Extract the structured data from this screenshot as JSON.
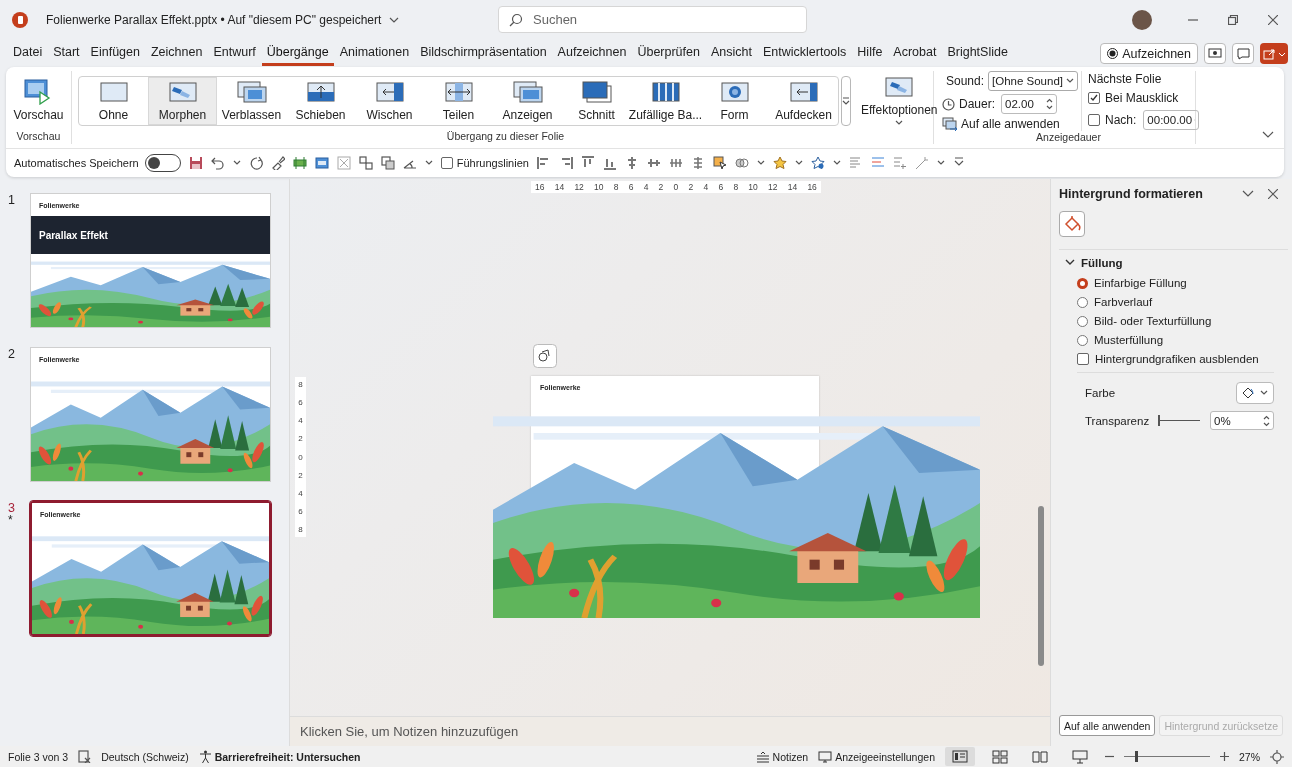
{
  "window": {
    "title": "Folienwerke Parallax Effekt.pptx • Auf \"diesem PC\" gespeichert"
  },
  "search": {
    "placeholder": "Suchen"
  },
  "menu": [
    {
      "label": "Datei",
      "selected": false
    },
    {
      "label": "Start",
      "selected": false
    },
    {
      "label": "Einfügen",
      "selected": false
    },
    {
      "label": "Zeichnen",
      "selected": false
    },
    {
      "label": "Entwurf",
      "selected": false
    },
    {
      "label": "Übergänge",
      "selected": true
    },
    {
      "label": "Animationen",
      "selected": false
    },
    {
      "label": "Bildschirmpräsentation",
      "selected": false
    },
    {
      "label": "Aufzeichnen",
      "selected": false
    },
    {
      "label": "Überprüfen",
      "selected": false
    },
    {
      "label": "Ansicht",
      "selected": false
    },
    {
      "label": "Entwicklertools",
      "selected": false
    },
    {
      "label": "Hilfe",
      "selected": false
    },
    {
      "label": "Acrobat",
      "selected": false
    },
    {
      "label": "BrightSlide",
      "selected": false
    }
  ],
  "record_button": "Aufzeichnen",
  "ribbon": {
    "preview": {
      "label": "Vorschau",
      "group": "Vorschau"
    },
    "transitions": {
      "group": "Übergang zu dieser Folie",
      "items": [
        {
          "label": "Ohne",
          "kind": "none",
          "selected": false
        },
        {
          "label": "Morphen",
          "kind": "morph",
          "selected": true
        },
        {
          "label": "Verblassen",
          "kind": "fade",
          "selected": false
        },
        {
          "label": "Schieben",
          "kind": "push",
          "selected": false
        },
        {
          "label": "Wischen",
          "kind": "wipe",
          "selected": false
        },
        {
          "label": "Teilen",
          "kind": "split",
          "selected": false
        },
        {
          "label": "Anzeigen",
          "kind": "reveal",
          "selected": false
        },
        {
          "label": "Schnitt",
          "kind": "cut",
          "selected": false
        },
        {
          "label": "Zufällige Ba...",
          "kind": "bars",
          "selected": false
        },
        {
          "label": "Form",
          "kind": "shape",
          "selected": false
        },
        {
          "label": "Aufdecken",
          "kind": "uncover",
          "selected": false
        }
      ]
    },
    "effect_options": "Effektoptionen",
    "timing": {
      "group": "Anzeigedauer",
      "sound_label": "Sound:",
      "sound_value": "[Ohne Sound]",
      "duration_label": "Dauer:",
      "duration_value": "02.00",
      "apply_all": "Auf alle anwenden",
      "next_slide": "Nächste Folie",
      "on_click": {
        "label": "Bei Mausklick",
        "checked": true
      },
      "after": {
        "label": "Nach:",
        "checked": false,
        "value": "00:00.00"
      }
    }
  },
  "quick_access": {
    "autosave_label": "Automatisches Speichern",
    "autosave_on": false,
    "guides": {
      "label": "Führungslinien",
      "checked": false
    }
  },
  "slides": [
    {
      "number": "1",
      "kind": "title",
      "brand": "Folienwerke",
      "title": "Parallax Effekt",
      "selected": false
    },
    {
      "number": "2",
      "kind": "content",
      "brand": "Folienwerke",
      "selected": false
    },
    {
      "number": "3",
      "kind": "content",
      "brand": "Folienwerke",
      "mark": "*",
      "selected": true
    }
  ],
  "rulers": {
    "horizontal": [
      "16",
      "14",
      "12",
      "10",
      "8",
      "6",
      "4",
      "2",
      "0",
      "2",
      "4",
      "6",
      "8",
      "10",
      "12",
      "14",
      "16"
    ],
    "vertical": [
      "8",
      "6",
      "4",
      "2",
      "0",
      "2",
      "4",
      "6",
      "8"
    ]
  },
  "canvas": {
    "slide_brand": "Folienwerke"
  },
  "notes": {
    "placeholder": "Klicken Sie, um Notizen hinzuzufügen"
  },
  "format_pane": {
    "title": "Hintergrund formatieren",
    "section": {
      "label": "Füllung",
      "expanded": true
    },
    "fill_options": [
      {
        "label": "Einfarbige Füllung",
        "selected": true
      },
      {
        "label": "Farbverlauf",
        "selected": false
      },
      {
        "label": "Bild- oder Texturfüllung",
        "selected": false
      },
      {
        "label": "Musterfüllung",
        "selected": false
      }
    ],
    "hide_graphics": {
      "label": "Hintergrundgrafiken ausblenden",
      "checked": false
    },
    "color_label": "Farbe",
    "transparency_label": "Transparenz",
    "transparency": {
      "level": 0,
      "value": "0%"
    },
    "apply_all": "Auf alle anwenden",
    "reset": {
      "label": "Hintergrund zurücksetze",
      "disabled": true
    }
  },
  "status_bar": {
    "slide": "Folie 3 von 3",
    "language": "Deutsch (Schweiz)",
    "accessibility": "Barrierefreiheit: Untersuchen",
    "notes": "Notizen",
    "display_settings": "Anzeigeeinstellungen",
    "views": [
      {
        "kind": "normal",
        "selected": true
      },
      {
        "kind": "sorter",
        "selected": false
      },
      {
        "kind": "reading",
        "selected": false
      },
      {
        "kind": "presenter",
        "selected": false
      }
    ],
    "zoom": {
      "level": 0.13,
      "value": "27%"
    }
  }
}
